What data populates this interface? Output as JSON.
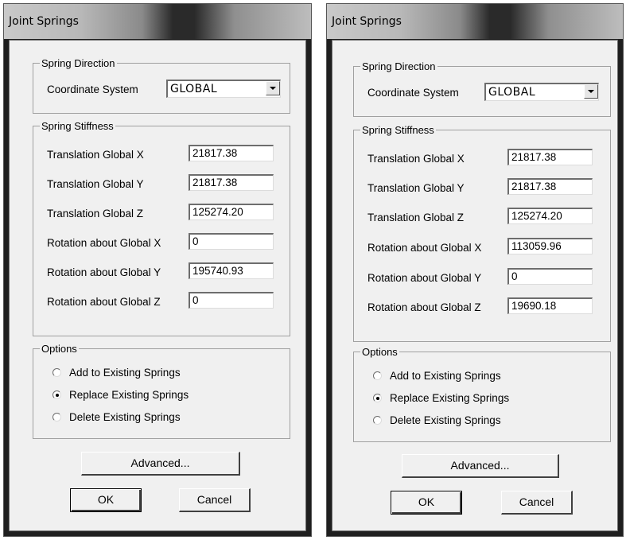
{
  "dialogs": [
    {
      "title": "Joint Springs",
      "spring_direction": {
        "legend": "Spring Direction",
        "coord_label": "Coordinate System",
        "coord_value": "GLOBAL"
      },
      "spring_stiffness": {
        "legend": "Spring Stiffness",
        "rows": [
          {
            "label": "Translation Global X",
            "value": "21817.38"
          },
          {
            "label": "Translation Global Y",
            "value": "21817.38"
          },
          {
            "label": "Translation Global Z",
            "value": "125274.20"
          },
          {
            "label": "Rotation about Global X",
            "value": "0"
          },
          {
            "label": "Rotation about Global Y",
            "value": "195740.93"
          },
          {
            "label": "Rotation about Global Z",
            "value": "0"
          }
        ]
      },
      "options": {
        "legend": "Options",
        "items": [
          {
            "label": "Add to Existing Springs",
            "checked": false
          },
          {
            "label": "Replace Existing Springs",
            "checked": true
          },
          {
            "label": "Delete Existing Springs",
            "checked": false
          }
        ]
      },
      "buttons": {
        "advanced": "Advanced...",
        "ok": "OK",
        "cancel": "Cancel"
      }
    },
    {
      "title": "Joint Springs",
      "spring_direction": {
        "legend": "Spring Direction",
        "coord_label": "Coordinate System",
        "coord_value": "GLOBAL"
      },
      "spring_stiffness": {
        "legend": "Spring Stiffness",
        "rows": [
          {
            "label": "Translation Global X",
            "value": "21817.38"
          },
          {
            "label": "Translation Global Y",
            "value": "21817.38"
          },
          {
            "label": "Translation Global Z",
            "value": "125274.20"
          },
          {
            "label": "Rotation about Global X",
            "value": "113059.96"
          },
          {
            "label": "Rotation about Global Y",
            "value": "0"
          },
          {
            "label": "Rotation about Global Z",
            "value": "19690.18"
          }
        ]
      },
      "options": {
        "legend": "Options",
        "items": [
          {
            "label": "Add to Existing Springs",
            "checked": false
          },
          {
            "label": "Replace Existing Springs",
            "checked": true
          },
          {
            "label": "Delete Existing Springs",
            "checked": false
          }
        ]
      },
      "buttons": {
        "advanced": "Advanced...",
        "ok": "OK",
        "cancel": "Cancel"
      }
    }
  ]
}
